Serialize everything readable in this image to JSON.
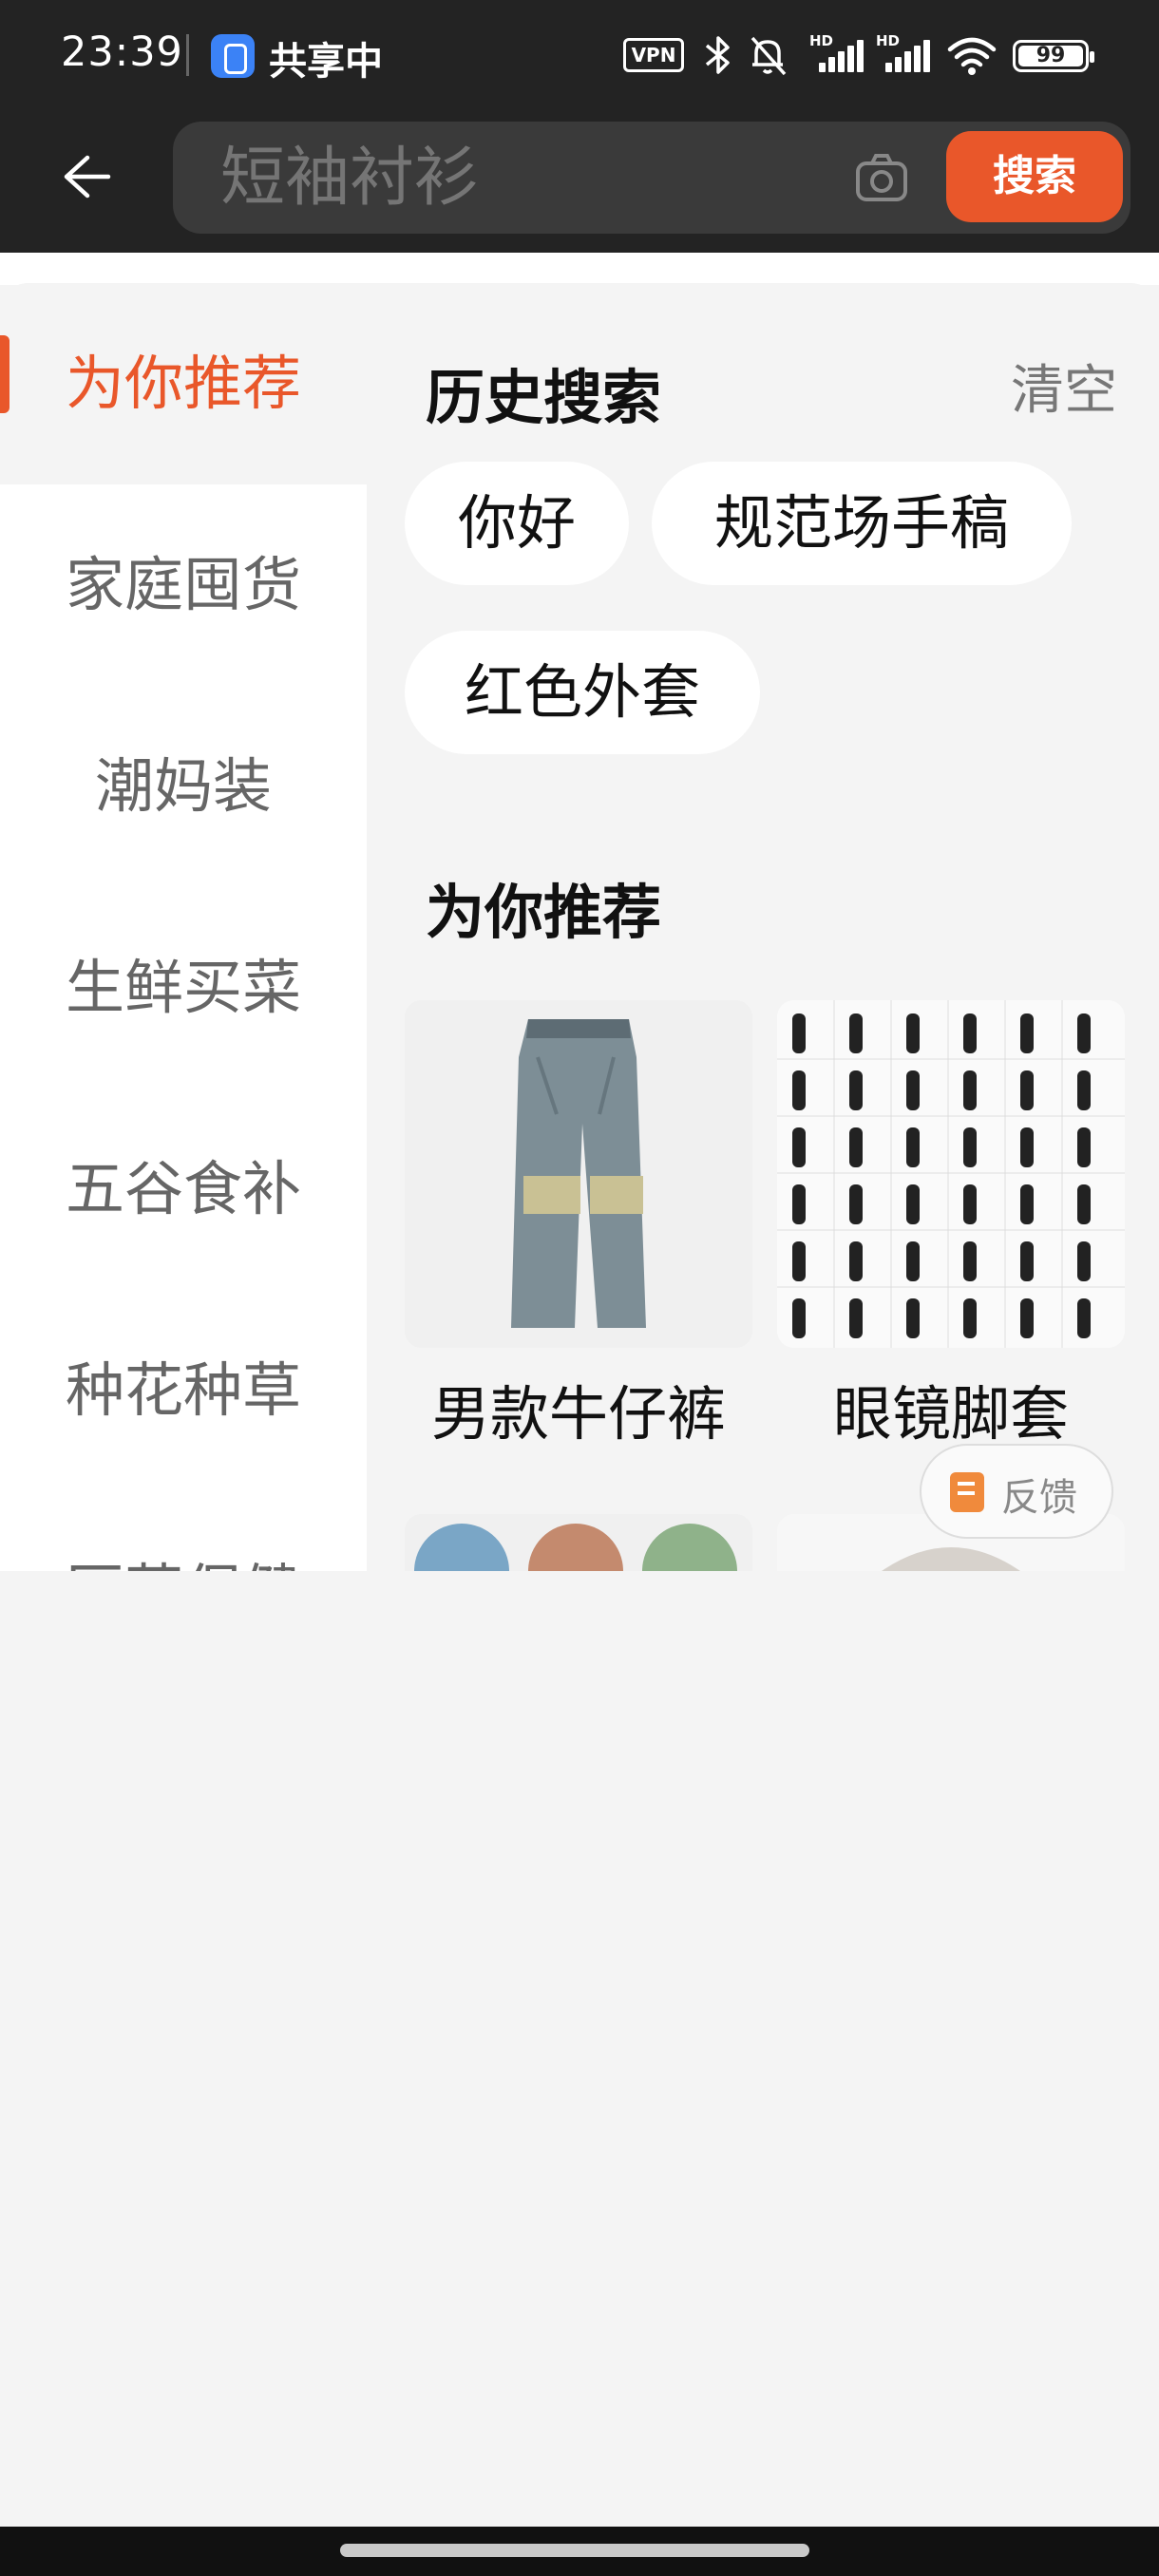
{
  "status_bar": {
    "time": "23:39",
    "sharing_label": "共享中",
    "vpn_label": "VPN",
    "signal_hd": "HD",
    "battery": "99"
  },
  "search": {
    "placeholder": "短袖衬衫",
    "button_label": "搜索"
  },
  "sidebar": {
    "items": [
      {
        "label": "为你推荐",
        "active": true
      },
      {
        "label": "家庭囤货"
      },
      {
        "label": "潮妈装"
      },
      {
        "label": "生鲜买菜"
      },
      {
        "label": "五谷食补"
      },
      {
        "label": "种花种草"
      },
      {
        "label": "医药保健"
      }
    ]
  },
  "history": {
    "title": "历史搜索",
    "clear_label": "清空",
    "chips": [
      "你好",
      "规范场手稿",
      "红色外套"
    ]
  },
  "recommend": {
    "title": "为你推荐",
    "products": [
      {
        "label": "男款牛仔裤",
        "image": "jeans-image"
      },
      {
        "label": "眼镜脚套",
        "image": "glasses-temple-covers-image"
      },
      {
        "label": "",
        "image": "patterned-shirts-image"
      },
      {
        "label": "",
        "image": "knit-sweater-image"
      }
    ]
  },
  "feedback": {
    "label": "反馈"
  },
  "colors": {
    "accent": "#e9572a",
    "header_bg": "#232323",
    "page_bg": "#f4f4f4"
  }
}
